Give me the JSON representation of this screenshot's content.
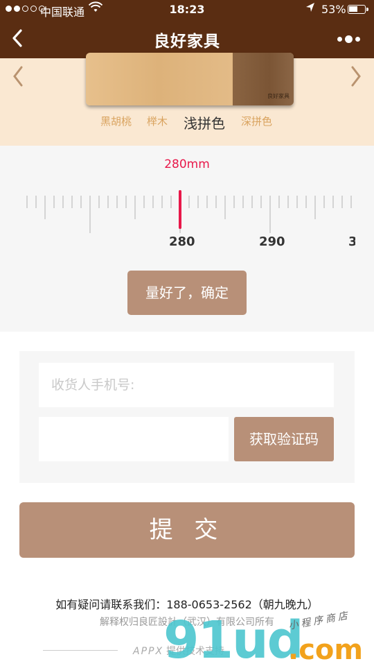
{
  "status_bar": {
    "carrier": "中国联通",
    "time": "18:23",
    "battery": "53%",
    "battery_level": 0.53
  },
  "nav": {
    "title": "良好家具"
  },
  "product": {
    "board_brand": "良好家具",
    "swatches": [
      {
        "label": "黑胡桃",
        "active": false
      },
      {
        "label": "榉木",
        "active": false
      },
      {
        "label": "浅拼色",
        "active": true
      },
      {
        "label": "深拼色",
        "active": false
      }
    ]
  },
  "ruler": {
    "value_label": "280mm",
    "value": 280,
    "tick_labels": [
      "280",
      "290",
      "3"
    ],
    "confirm_label": "量好了，确定"
  },
  "form": {
    "phone_placeholder": "收货人手机号:",
    "code_value": "",
    "get_code_label": "获取验证码"
  },
  "submit_label": "提 交",
  "footer": {
    "contact": "如有疑问请联系我们：188-0653-2562（朝九晚九）",
    "copyright": "解释权归良匠設計（武汉）有限公司所有",
    "support_brand": "APPX",
    "support_text": "提供技术支持"
  },
  "watermark": {
    "main": "91ud",
    "domain": ".com",
    "tagline": "小程序商店"
  },
  "colors": {
    "header_bg": "#5a2d12",
    "product_bg": "#fae8d2",
    "accent_button": "#b89078",
    "measure_red": "#e8184a",
    "swatch_text": "#d9a35f"
  }
}
